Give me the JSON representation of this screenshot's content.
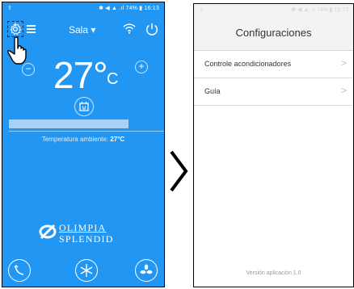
{
  "left_screen": {
    "status_bar": {
      "left_icon": "notification-icon",
      "battery": "74%",
      "time": "16:13"
    },
    "header": {
      "room_label": "Sala",
      "room_dropdown_icon": "caret-down-icon"
    },
    "temperature": {
      "value": "27°",
      "unit": "C"
    },
    "controls": {
      "minus": "−",
      "plus": "+",
      "calendar_label": "M"
    },
    "setpoint_bar": {
      "fill_fraction": 0.8
    },
    "ambient": {
      "label": "Temperatura ambiente:",
      "value": "27°C"
    },
    "brand": {
      "line1": "OLIMPIA",
      "line2": "SPLENDID"
    }
  },
  "right_screen": {
    "status_bar": {
      "battery": "74%",
      "time": "16:13"
    },
    "title": "Configuraciones",
    "items": [
      {
        "label": "Controle acondicionadores"
      },
      {
        "label": "Guía"
      }
    ],
    "version": "Versión aplicación 1.0"
  },
  "colors": {
    "primary": "#2196f3",
    "bar_fill": "#a7d2f6",
    "white": "#ffffff"
  }
}
